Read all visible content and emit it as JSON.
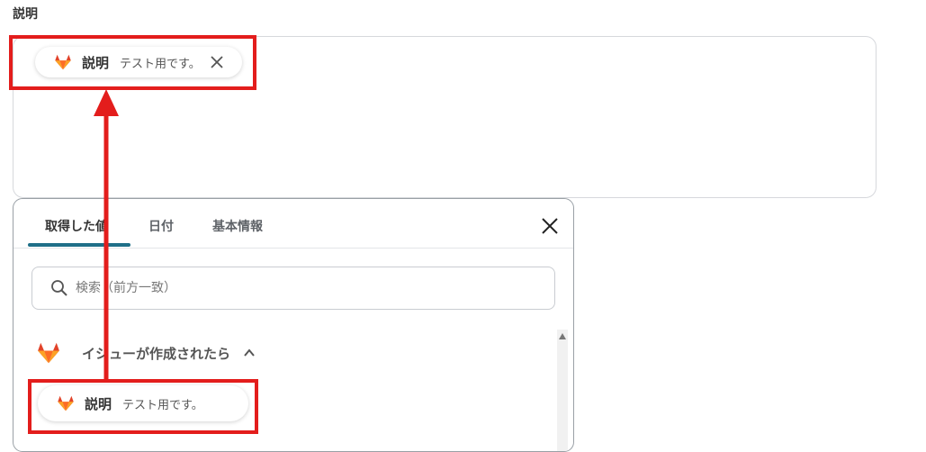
{
  "field": {
    "label": "説明"
  },
  "selected_chip": {
    "name": "説明",
    "value": "テスト用です。"
  },
  "panel": {
    "tabs": [
      {
        "label": "取得した値"
      },
      {
        "label": "日付"
      },
      {
        "label": "基本情報"
      }
    ],
    "active_tab": 0,
    "search": {
      "placeholder": "検索（前方一致）",
      "value": ""
    },
    "group": {
      "title": "イシューが作成されたら",
      "expanded": true
    },
    "items": [
      {
        "name": "説明",
        "value": "テスト用です。"
      }
    ]
  },
  "colors": {
    "annotation_red": "#e31d1c",
    "tab_accent": "#1f6f88",
    "gitlab_orange": "#fc6d26",
    "gitlab_red": "#e24329",
    "gitlab_light": "#fca326"
  }
}
